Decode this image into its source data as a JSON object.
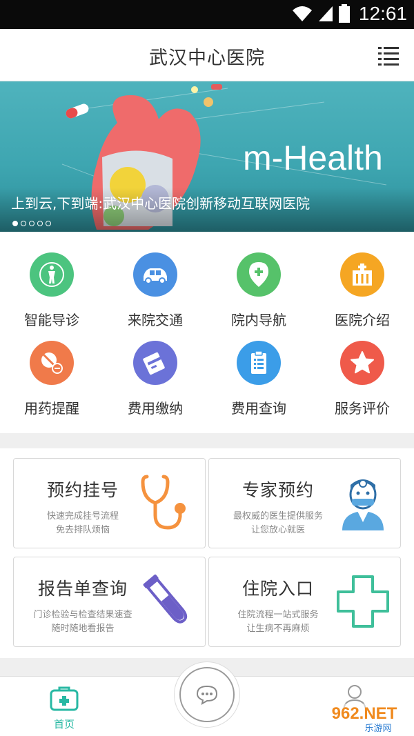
{
  "status_bar": {
    "time": "12:61",
    "icons": [
      "wifi-icon",
      "signal-icon",
      "battery-icon"
    ]
  },
  "header": {
    "title": "武汉中心医院",
    "menu_icon": "menu-grid-icon"
  },
  "banner": {
    "caption": "上到云,下到端:武汉中心医院创新移动互联网医院",
    "brand_text": "m-Health",
    "dots": 5,
    "active_dot": 0
  },
  "grid": {
    "items": [
      {
        "label": "智能导诊",
        "icon": "body-guide-icon",
        "color": "#4cc47f"
      },
      {
        "label": "来院交通",
        "icon": "car-icon",
        "color": "#4a90e2"
      },
      {
        "label": "院内导航",
        "icon": "location-pin-icon",
        "color": "#56c26a"
      },
      {
        "label": "医院介绍",
        "icon": "hospital-building-icon",
        "color": "#f5a623"
      },
      {
        "label": "用药提醒",
        "icon": "pill-icon",
        "color": "#f07a4a"
      },
      {
        "label": "费用缴纳",
        "icon": "card-icon",
        "color": "#6b72d8"
      },
      {
        "label": "费用查询",
        "icon": "clipboard-list-icon",
        "color": "#3b9de8"
      },
      {
        "label": "服务评价",
        "icon": "star-icon",
        "color": "#ef5a4a"
      }
    ]
  },
  "cards": [
    {
      "title": "预约挂号",
      "sub1": "快速完成挂号流程",
      "sub2": "免去排队烦恼",
      "icon": "stethoscope-icon"
    },
    {
      "title": "专家预约",
      "sub1": "最权威的医生提供服务",
      "sub2": "让您放心就医",
      "icon": "doctor-icon"
    },
    {
      "title": "报告单查询",
      "sub1": "门诊检验与检查结果速查",
      "sub2": "随时随地看报告",
      "icon": "test-tube-icon"
    },
    {
      "title": "住院入口",
      "sub1": "住院流程一站式服务",
      "sub2": "让生病不再麻烦",
      "icon": "cross-icon"
    }
  ],
  "tabbar": {
    "home_label": "首页",
    "home_icon": "medical-kit-icon",
    "center_icon": "chat-bubble-icon",
    "profile_icon": "user-icon"
  },
  "watermark": {
    "text": "962.NET",
    "sub": "乐游网"
  },
  "colors": {
    "accent": "#27b8a3",
    "banner": "#3ea6b1"
  }
}
